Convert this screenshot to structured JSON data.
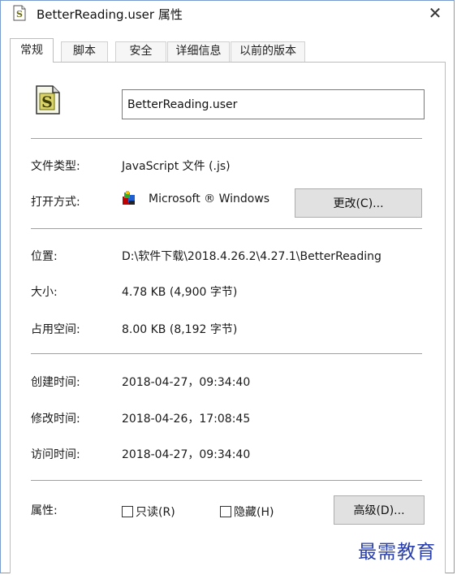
{
  "window": {
    "title": "BetterReading.user 属性",
    "close_label": "✕",
    "title_icon": "script-file-icon",
    "accent_color": "#7a9ccf"
  },
  "tabs": [
    {
      "label": "常规",
      "active": true
    },
    {
      "label": "脚本",
      "active": false
    },
    {
      "label": "安全",
      "active": false
    },
    {
      "label": "详细信息",
      "active": false
    },
    {
      "label": "以前的版本",
      "active": false
    }
  ],
  "general": {
    "file_icon": "script-file-icon",
    "file_name": "BetterReading.user",
    "file_type_label": "文件类型:",
    "file_type_value": "JavaScript 文件 (.js)",
    "open_with_label": "打开方式:",
    "open_with_app_icon": "windows-script-host-icon",
    "open_with_app": "Microsoft ® Windows",
    "change_button": "更改(C)...",
    "location_label": "位置:",
    "location_value": "D:\\软件下载\\2018.4.26.2\\4.27.1\\BetterReading",
    "size_label": "大小:",
    "size_value": "4.78 KB (4,900 字节)",
    "size_on_disk_label": "占用空间:",
    "size_on_disk_value": "8.00 KB (8,192 字节)",
    "created_label": "创建时间:",
    "created_value": "2018-04-27，09:34:40",
    "modified_label": "修改时间:",
    "modified_value": "2018-04-26，17:08:45",
    "accessed_label": "访问时间:",
    "accessed_value": "2018-04-27，09:34:40",
    "attributes_label": "属性:",
    "readonly_label": "只读(R)",
    "readonly_checked": false,
    "hidden_label": "隐藏(H)",
    "hidden_checked": false,
    "advanced_button": "高级(D)..."
  },
  "watermark": "最需教育"
}
